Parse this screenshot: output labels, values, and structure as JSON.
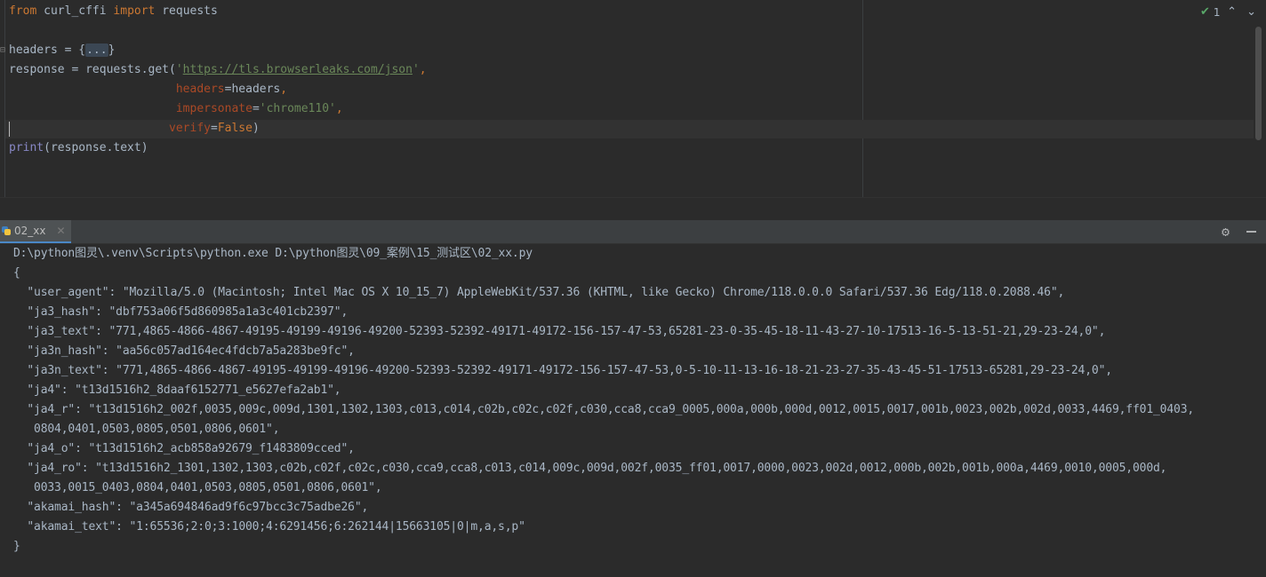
{
  "editor": {
    "code_lines": [
      "from curl_cffi import requests",
      "",
      "headers = {...}",
      "response = requests.get('https://tls.browserleaks.com/json',",
      "                        headers=headers,",
      "                        impersonate='chrome110',",
      "                       verify=False)",
      "print(response.text)"
    ],
    "tokens": {
      "from": "from",
      "module": "curl_cffi",
      "import": "import",
      "requests": "requests",
      "headers_assign": "headers = {",
      "folded": "...",
      "close_brace": "}",
      "response_assign": "response = requests.get(",
      "quote": "'",
      "url": "https://tls.browserleaks.com/json",
      "quote_comma": "',",
      "indent1": "                        ",
      "indent2": "                       ",
      "kw_headers": "headers",
      "eq": "=",
      "headers_val": "headers",
      "comma": ",",
      "kw_impersonate": "impersonate",
      "impersonate_val": "'chrome110'",
      "kw_verify": "verify",
      "verify_val": "False",
      "close_paren": ")",
      "print": "print",
      "print_arg": "(response.text)"
    },
    "inspection_count": "1"
  },
  "run": {
    "tab_label": "02_xx",
    "output_lines": [
      "D:\\python图灵\\.venv\\Scripts\\python.exe D:\\python图灵\\09_案例\\15_测试区\\02_xx.py",
      "{",
      "  \"user_agent\": \"Mozilla/5.0 (Macintosh; Intel Mac OS X 10_15_7) AppleWebKit/537.36 (KHTML, like Gecko) Chrome/118.0.0.0 Safari/537.36 Edg/118.0.2088.46\",",
      "  \"ja3_hash\": \"dbf753a06f5d860985a1a3c401cb2397\",",
      "  \"ja3_text\": \"771,4865-4866-4867-49195-49199-49196-49200-52393-52392-49171-49172-156-157-47-53,65281-23-0-35-45-18-11-43-27-10-17513-16-5-13-51-21,29-23-24,0\",",
      "  \"ja3n_hash\": \"aa56c057ad164ec4fdcb7a5a283be9fc\",",
      "  \"ja3n_text\": \"771,4865-4866-4867-49195-49199-49196-49200-52393-52392-49171-49172-156-157-47-53,0-5-10-11-13-16-18-21-23-27-35-43-45-51-17513-65281,29-23-24,0\",",
      "  \"ja4\": \"t13d1516h2_8daaf6152771_e5627efa2ab1\",",
      "  \"ja4_r\": \"t13d1516h2_002f,0035,009c,009d,1301,1302,1303,c013,c014,c02b,c02c,c02f,c030,cca8,cca9_0005,000a,000b,000d,0012,0015,0017,001b,0023,002b,002d,0033,4469,ff01_0403,",
      "   0804,0401,0503,0805,0501,0806,0601\",",
      "  \"ja4_o\": \"t13d1516h2_acb858a92679_f1483809cced\",",
      "  \"ja4_ro\": \"t13d1516h2_1301,1302,1303,c02b,c02f,c02c,c030,cca9,cca8,c013,c014,009c,009d,002f,0035_ff01,0017,0000,0023,002d,0012,000b,002b,001b,000a,4469,0010,0005,000d,",
      "   0033,0015_0403,0804,0401,0503,0805,0501,0806,0601\",",
      "  \"akamai_hash\": \"a345a694846ad9f6c97bcc3c75adbe26\",",
      "  \"akamai_text\": \"1:65536;2:0;3:1000;4:6291456;6:262144|15663105|0|m,a,s,p\"",
      "}"
    ]
  },
  "icons": {
    "tab_icon": "python-file-icon",
    "settings": "gear-icon",
    "minimize": "minimize-icon",
    "close_tab": "close-icon",
    "inspections_ok": "check-icon"
  }
}
